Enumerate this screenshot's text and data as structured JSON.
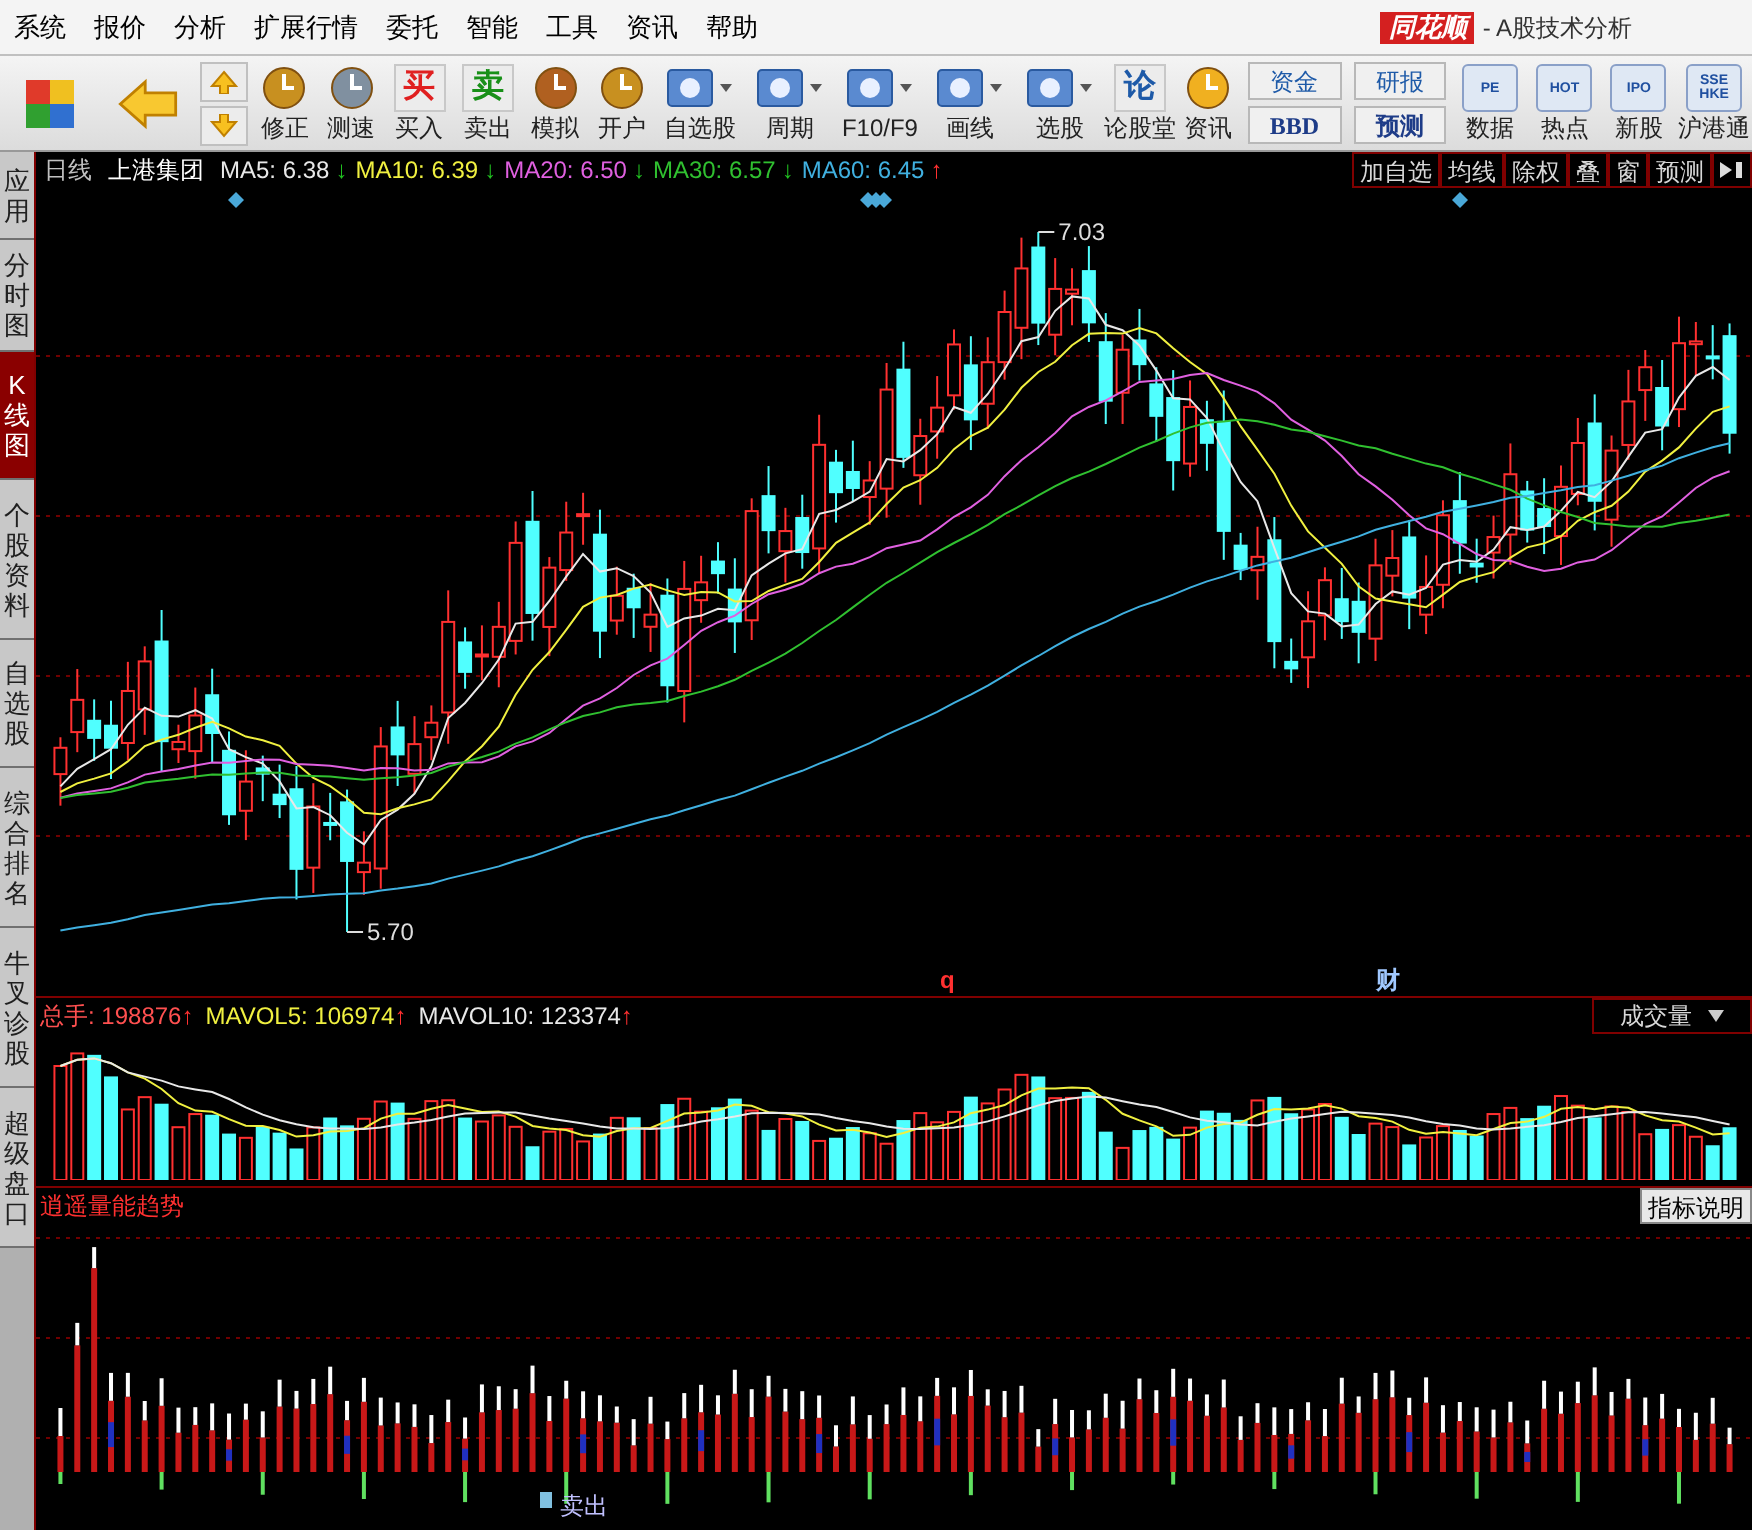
{
  "menu": [
    "系统",
    "报价",
    "分析",
    "扩展行情",
    "委托",
    "智能",
    "工具",
    "资讯",
    "帮助"
  ],
  "brand": {
    "logo": "同花顺",
    "title": "- A股技术分析"
  },
  "toolbar": [
    {
      "kind": "logo"
    },
    {
      "kind": "back"
    },
    {
      "kind": "updown"
    },
    {
      "kind": "icon",
      "label": "修正"
    },
    {
      "kind": "icon",
      "label": "测速"
    },
    {
      "kind": "glyph",
      "glyph": "买",
      "color": "#e02020",
      "label": "买入"
    },
    {
      "kind": "glyph",
      "glyph": "卖",
      "color": "#189018",
      "label": "卖出"
    },
    {
      "kind": "icon",
      "label": "模拟"
    },
    {
      "kind": "icon",
      "label": "开户"
    },
    {
      "kind": "dropdown",
      "label": "自选股"
    },
    {
      "kind": "dropdown",
      "label": "周期"
    },
    {
      "kind": "dropdown",
      "label": "F10/F9"
    },
    {
      "kind": "dropdown",
      "label": "画线"
    },
    {
      "kind": "dropdown",
      "label": "选股"
    },
    {
      "kind": "glyph",
      "glyph": "论",
      "color": "#1e5aa8",
      "label": "论股堂"
    },
    {
      "kind": "icon",
      "label": "资讯"
    },
    {
      "kind": "pair",
      "top": "资金",
      "bottom": "BBD"
    },
    {
      "kind": "pair",
      "top": "研报",
      "bottom": "预测"
    },
    {
      "kind": "badge",
      "glyph": "PE",
      "label": "数据"
    },
    {
      "kind": "badge",
      "glyph": "HOT",
      "label": "热点"
    },
    {
      "kind": "badge",
      "glyph": "IPO",
      "label": "新股"
    },
    {
      "kind": "badge",
      "glyph": "SSE HKE",
      "label": "沪港通"
    }
  ],
  "sidebar": [
    {
      "label": "应用",
      "selected": false
    },
    {
      "label": "分时图",
      "selected": false
    },
    {
      "label": "K线图",
      "selected": true
    },
    {
      "label": "个股资料",
      "selected": false
    },
    {
      "label": "自选股",
      "selected": false
    },
    {
      "label": "综合排名",
      "selected": false
    },
    {
      "label": "牛叉诊股",
      "selected": false
    },
    {
      "label": "超级盘口",
      "selected": false
    }
  ],
  "info": {
    "period": "日线",
    "stock": "上港集团",
    "mas": [
      {
        "label": "MA5: 6.38",
        "arrow": {
          "text": "↓",
          "color": "#20c020"
        },
        "color": "#e8e8e8"
      },
      {
        "label": "MA10: 6.39",
        "arrow": {
          "text": "↓",
          "color": "#20c020"
        },
        "color": "#f0f040"
      },
      {
        "label": "MA20: 6.50",
        "arrow": {
          "text": "↓",
          "color": "#20c020"
        },
        "color": "#e060e0"
      },
      {
        "label": "MA30: 6.57",
        "arrow": {
          "text": "↓",
          "color": "#20c020"
        },
        "color": "#30c030"
      },
      {
        "label": "MA60: 6.45",
        "arrow": {
          "text": "↑",
          "color": "#ff3030"
        },
        "color": "#40b0e0"
      }
    ]
  },
  "chart_buttons": [
    "加自选",
    "均线",
    "除权",
    "叠",
    "窗",
    "预测"
  ],
  "price_chart": {
    "high_label": "7.03",
    "low_label": "5.70",
    "markers": [
      "q",
      "财"
    ]
  },
  "volume": {
    "items": [
      {
        "label": "总手: 198876",
        "arrow": "↑",
        "color": "#ff5050"
      },
      {
        "label": "MAVOL5: 106974",
        "arrow": "↑",
        "color": "#f0f040"
      },
      {
        "label": "MAVOL10: 123374",
        "arrow": "↑",
        "color": "#e8e8e8"
      }
    ],
    "selector": "成交量"
  },
  "indicator": {
    "title": "逍遥量能趋势",
    "help": "指标说明",
    "signal_label": "卖出"
  }
}
